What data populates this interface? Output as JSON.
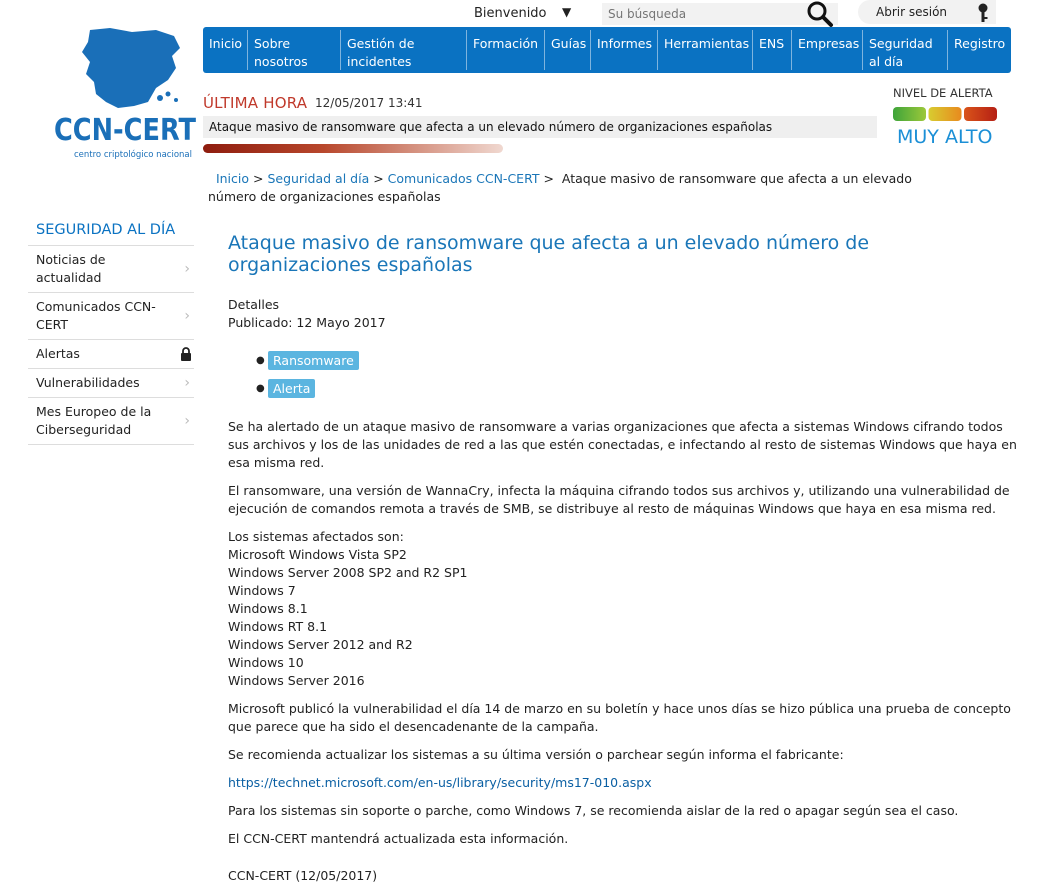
{
  "topbar": {
    "welcome": "Bienvenido",
    "search_placeholder": "Su búsqueda",
    "login": "Abrir sesión"
  },
  "logo": {
    "brand": "CCN-CERT",
    "tagline": "centro criptológico nacional",
    "brand_color": "#1a6fb8"
  },
  "nav": {
    "items": [
      {
        "label": "Inicio"
      },
      {
        "label": "Sobre nosotros"
      },
      {
        "label": "Gestión de incidentes"
      },
      {
        "label": "Formación"
      },
      {
        "label": "Guías"
      },
      {
        "label": "Informes"
      },
      {
        "label": "Herramientas"
      },
      {
        "label": "ENS"
      },
      {
        "label": "Empresas"
      },
      {
        "label": "Seguridad al día"
      },
      {
        "label": "Registro"
      }
    ],
    "color": "#0a72c2"
  },
  "ultima_hora": {
    "title": "ÚLTIMA HORA",
    "date": "12/05/2017 13:41",
    "headline": "Ataque masivo de ransomware que afecta a un elevado número de organizaciones españolas"
  },
  "alert": {
    "label": "NIVEL DE ALERTA",
    "level": "MUY ALTO",
    "level_color": "#1b8fd6"
  },
  "breadcrumb": {
    "items": [
      "Inicio",
      "Seguridad al día",
      "Comunicados CCN-CERT"
    ],
    "current": "Ataque masivo de ransomware que afecta a un elevado número de organizaciones españolas"
  },
  "sidebar": {
    "title": "SEGURIDAD AL DÍA",
    "items": [
      {
        "label": "Noticias de actualidad",
        "icon": "chevron-right-icon"
      },
      {
        "label": "Comunicados CCN-CERT",
        "icon": "chevron-right-icon"
      },
      {
        "label": "Alertas",
        "icon": "lock-icon"
      },
      {
        "label": "Vulnerabilidades",
        "icon": "chevron-right-icon"
      },
      {
        "label": "Mes Europeo de la Ciberseguridad",
        "icon": "chevron-right-icon"
      }
    ]
  },
  "article": {
    "title": "Ataque masivo de ransomware que afecta a un elevado número de organizaciones españolas",
    "details_label": "Detalles",
    "published": "Publicado: 12 Mayo 2017",
    "tags": [
      "Ransomware",
      "Alerta"
    ],
    "p1": "Se ha alertado de un ataque masivo de ransomware a varias organizaciones que afecta a sistemas Windows cifrando todos sus archivos y los de las unidades de red a las que estén conectadas, e infectando al resto de sistemas Windows que haya en esa misma red.",
    "p2": "El ransomware, una versión de WannaCry, infecta la máquina cifrando todos sus archivos y, utilizando una vulnerabilidad de ejecución de comandos remota a través de SMB, se distribuye al resto de máquinas Windows que haya en esa misma red.",
    "systems_intro": "Los sistemas afectados son:",
    "systems": [
      "Microsoft Windows Vista SP2",
      "Windows Server 2008 SP2 and R2 SP1",
      "Windows 7",
      "Windows 8.1",
      "Windows RT 8.1",
      "Windows Server 2012 and R2",
      "Windows 10",
      "Windows Server 2016"
    ],
    "p3": "Microsoft publicó la vulnerabilidad el día 14 de marzo en su boletín y hace unos días se hizo pública una prueba de concepto que parece que ha sido el desencadenante de la campaña.",
    "p4": "Se recomienda actualizar los sistemas a su última versión o parchear según informa el fabricante:",
    "link": "https://technet.microsoft.com/en-us/library/security/ms17-010.aspx",
    "p5": "Para los sistemas sin soporte o parche, como Windows 7, se recomienda aislar de la red o apagar según sea el caso.",
    "p6": "El CCN-CERT mantendrá actualizada esta información.",
    "signature": "CCN-CERT (12/05/2017)"
  }
}
